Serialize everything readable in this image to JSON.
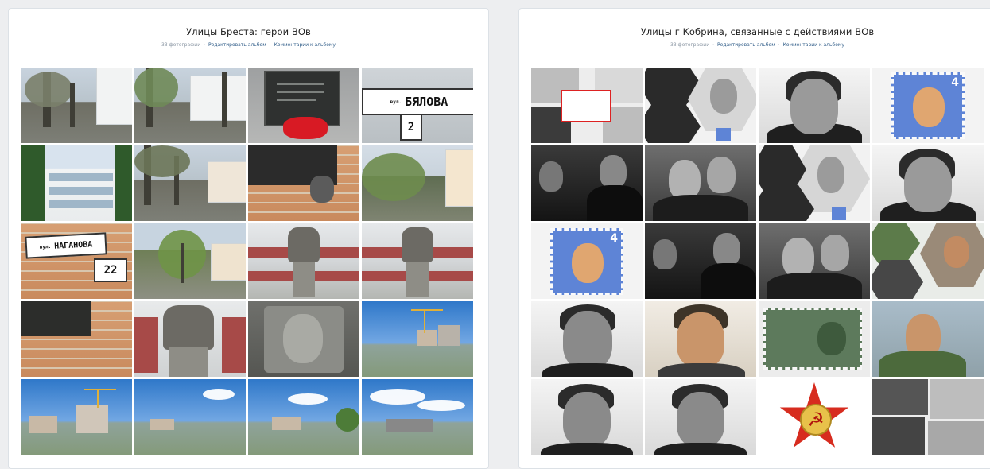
{
  "albums": [
    {
      "title": "Улицы Бреста: герои ВОв",
      "count": "33 фотографии",
      "edit": "Редактировать альбом",
      "comments": "Комментарии к альбому",
      "signs": {
        "byalova_prefix": "вул.",
        "byalova_name": "БЯЛОВА",
        "byalova_num": "2",
        "naganova_prefix": "вул.",
        "naganova_name": "НАГАНОВА",
        "naganova_num": "22"
      }
    },
    {
      "title": "Улицы г Кобрина, связанные с действиями ВОв",
      "count": "33 фотографии",
      "edit": "Редактировать альбом",
      "comments": "Комментарии к альбому",
      "stamp_value": "4",
      "order_symbol": "☭"
    }
  ],
  "colors": {
    "page_bg": "#edeef0",
    "card_bg": "#ffffff",
    "link": "#2a5885",
    "meta": "#8a96a3"
  }
}
